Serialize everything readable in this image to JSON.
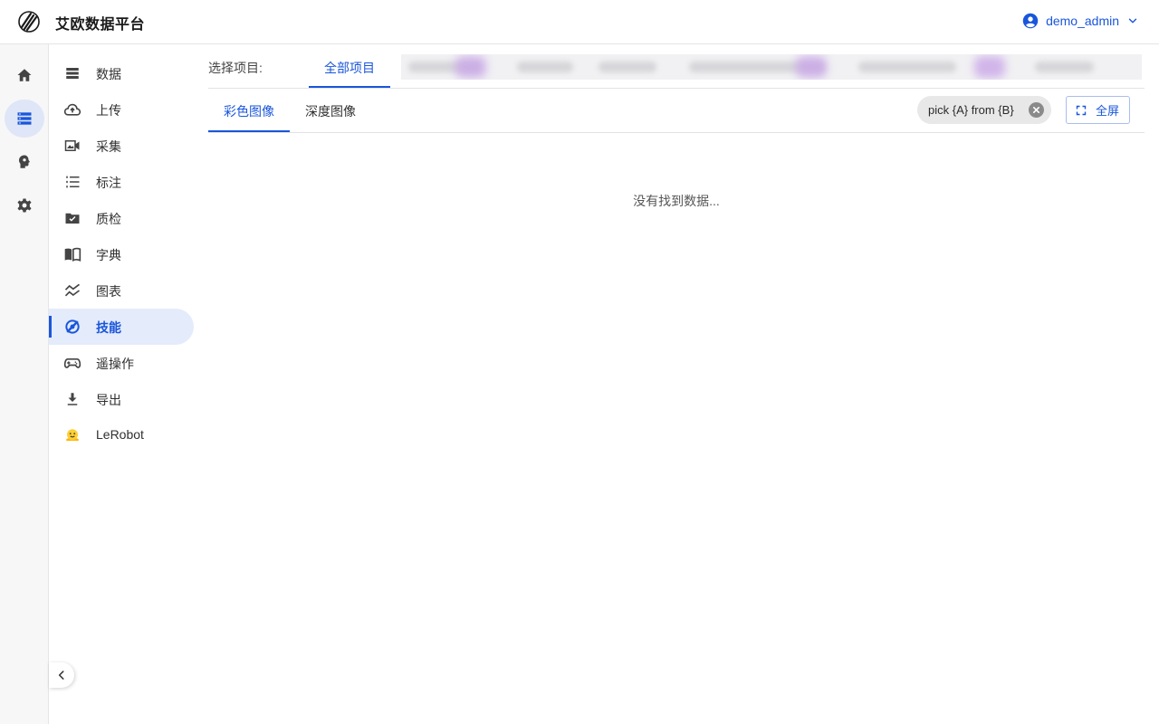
{
  "app": {
    "title": "艾欧数据平台"
  },
  "user": {
    "name": "demo_admin"
  },
  "sidebar": {
    "items": [
      {
        "label": "数据",
        "icon": "storage-icon"
      },
      {
        "label": "上传",
        "icon": "cloud-upload-icon"
      },
      {
        "label": "采集",
        "icon": "video-camera-icon"
      },
      {
        "label": "标注",
        "icon": "numbered-list-icon"
      },
      {
        "label": "质检",
        "icon": "folder-check-icon"
      },
      {
        "label": "字典",
        "icon": "book-icon"
      },
      {
        "label": "图表",
        "icon": "chart-line-icon"
      },
      {
        "label": "技能",
        "icon": "skill-icon",
        "active": true
      },
      {
        "label": "遥操作",
        "icon": "gamepad-icon"
      },
      {
        "label": "导出",
        "icon": "download-icon"
      },
      {
        "label": "LeRobot",
        "icon": "hugging-face-icon"
      }
    ]
  },
  "projects": {
    "label": "选择项目:",
    "all_tab": "全部项目"
  },
  "image_tabs": [
    "彩色图像",
    "深度图像"
  ],
  "filter_chip": {
    "label": "pick {A} from {B}"
  },
  "fullscreen": {
    "label": "全屏"
  },
  "empty_state": {
    "message": "没有找到数据..."
  },
  "colors": {
    "accent": "#1a56db",
    "active_bg": "#e4ebfb"
  }
}
